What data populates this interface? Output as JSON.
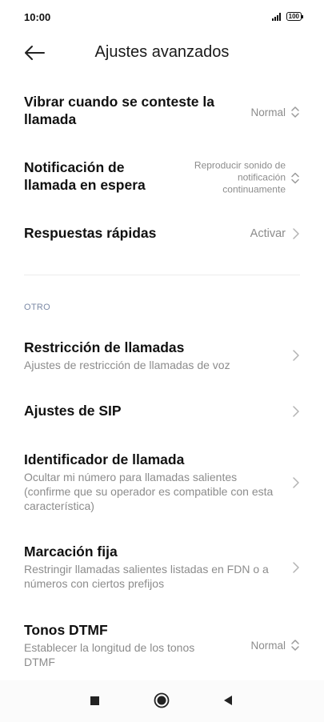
{
  "status": {
    "time": "10:00",
    "battery": "100"
  },
  "header": {
    "title": "Ajustes avanzados"
  },
  "items": [
    {
      "title": "Vibrar cuando se conteste la llamada",
      "value": "Normal",
      "control": "updown"
    },
    {
      "title": "Notificación de llamada en espera",
      "value": "Reproducir sonido de notificación continuamente",
      "control": "updown"
    },
    {
      "title": "Respuestas rápidas",
      "value": "Activar",
      "control": "chevron"
    }
  ],
  "section_other": "OTRO",
  "other_items": [
    {
      "title": "Restricción de llamadas",
      "subtitle": "Ajustes de restricción de llamadas de voz",
      "control": "chevron"
    },
    {
      "title": "Ajustes de SIP",
      "control": "chevron"
    },
    {
      "title": "Identificador de llamada",
      "subtitle": "Ocultar mi número para llamadas salientes (confirme que su operador es compatible con esta característica)",
      "control": "chevron"
    },
    {
      "title": "Marcación fija",
      "subtitle": "Restringir llamadas salientes listadas en FDN o a números con ciertos prefijos",
      "control": "chevron"
    },
    {
      "title": "Tonos DTMF",
      "subtitle": "Establecer la longitud de los tonos DTMF",
      "value": "Normal",
      "control": "updown"
    }
  ],
  "icons": {
    "back": "arrow-left",
    "updown": "chevron-up-down",
    "chevron": "chevron-right",
    "nav_recent": "square",
    "nav_home": "circle",
    "nav_back": "triangle-left"
  },
  "colors": {
    "secondary_text": "#8c8c8c",
    "section_label": "#7c8aa6"
  }
}
